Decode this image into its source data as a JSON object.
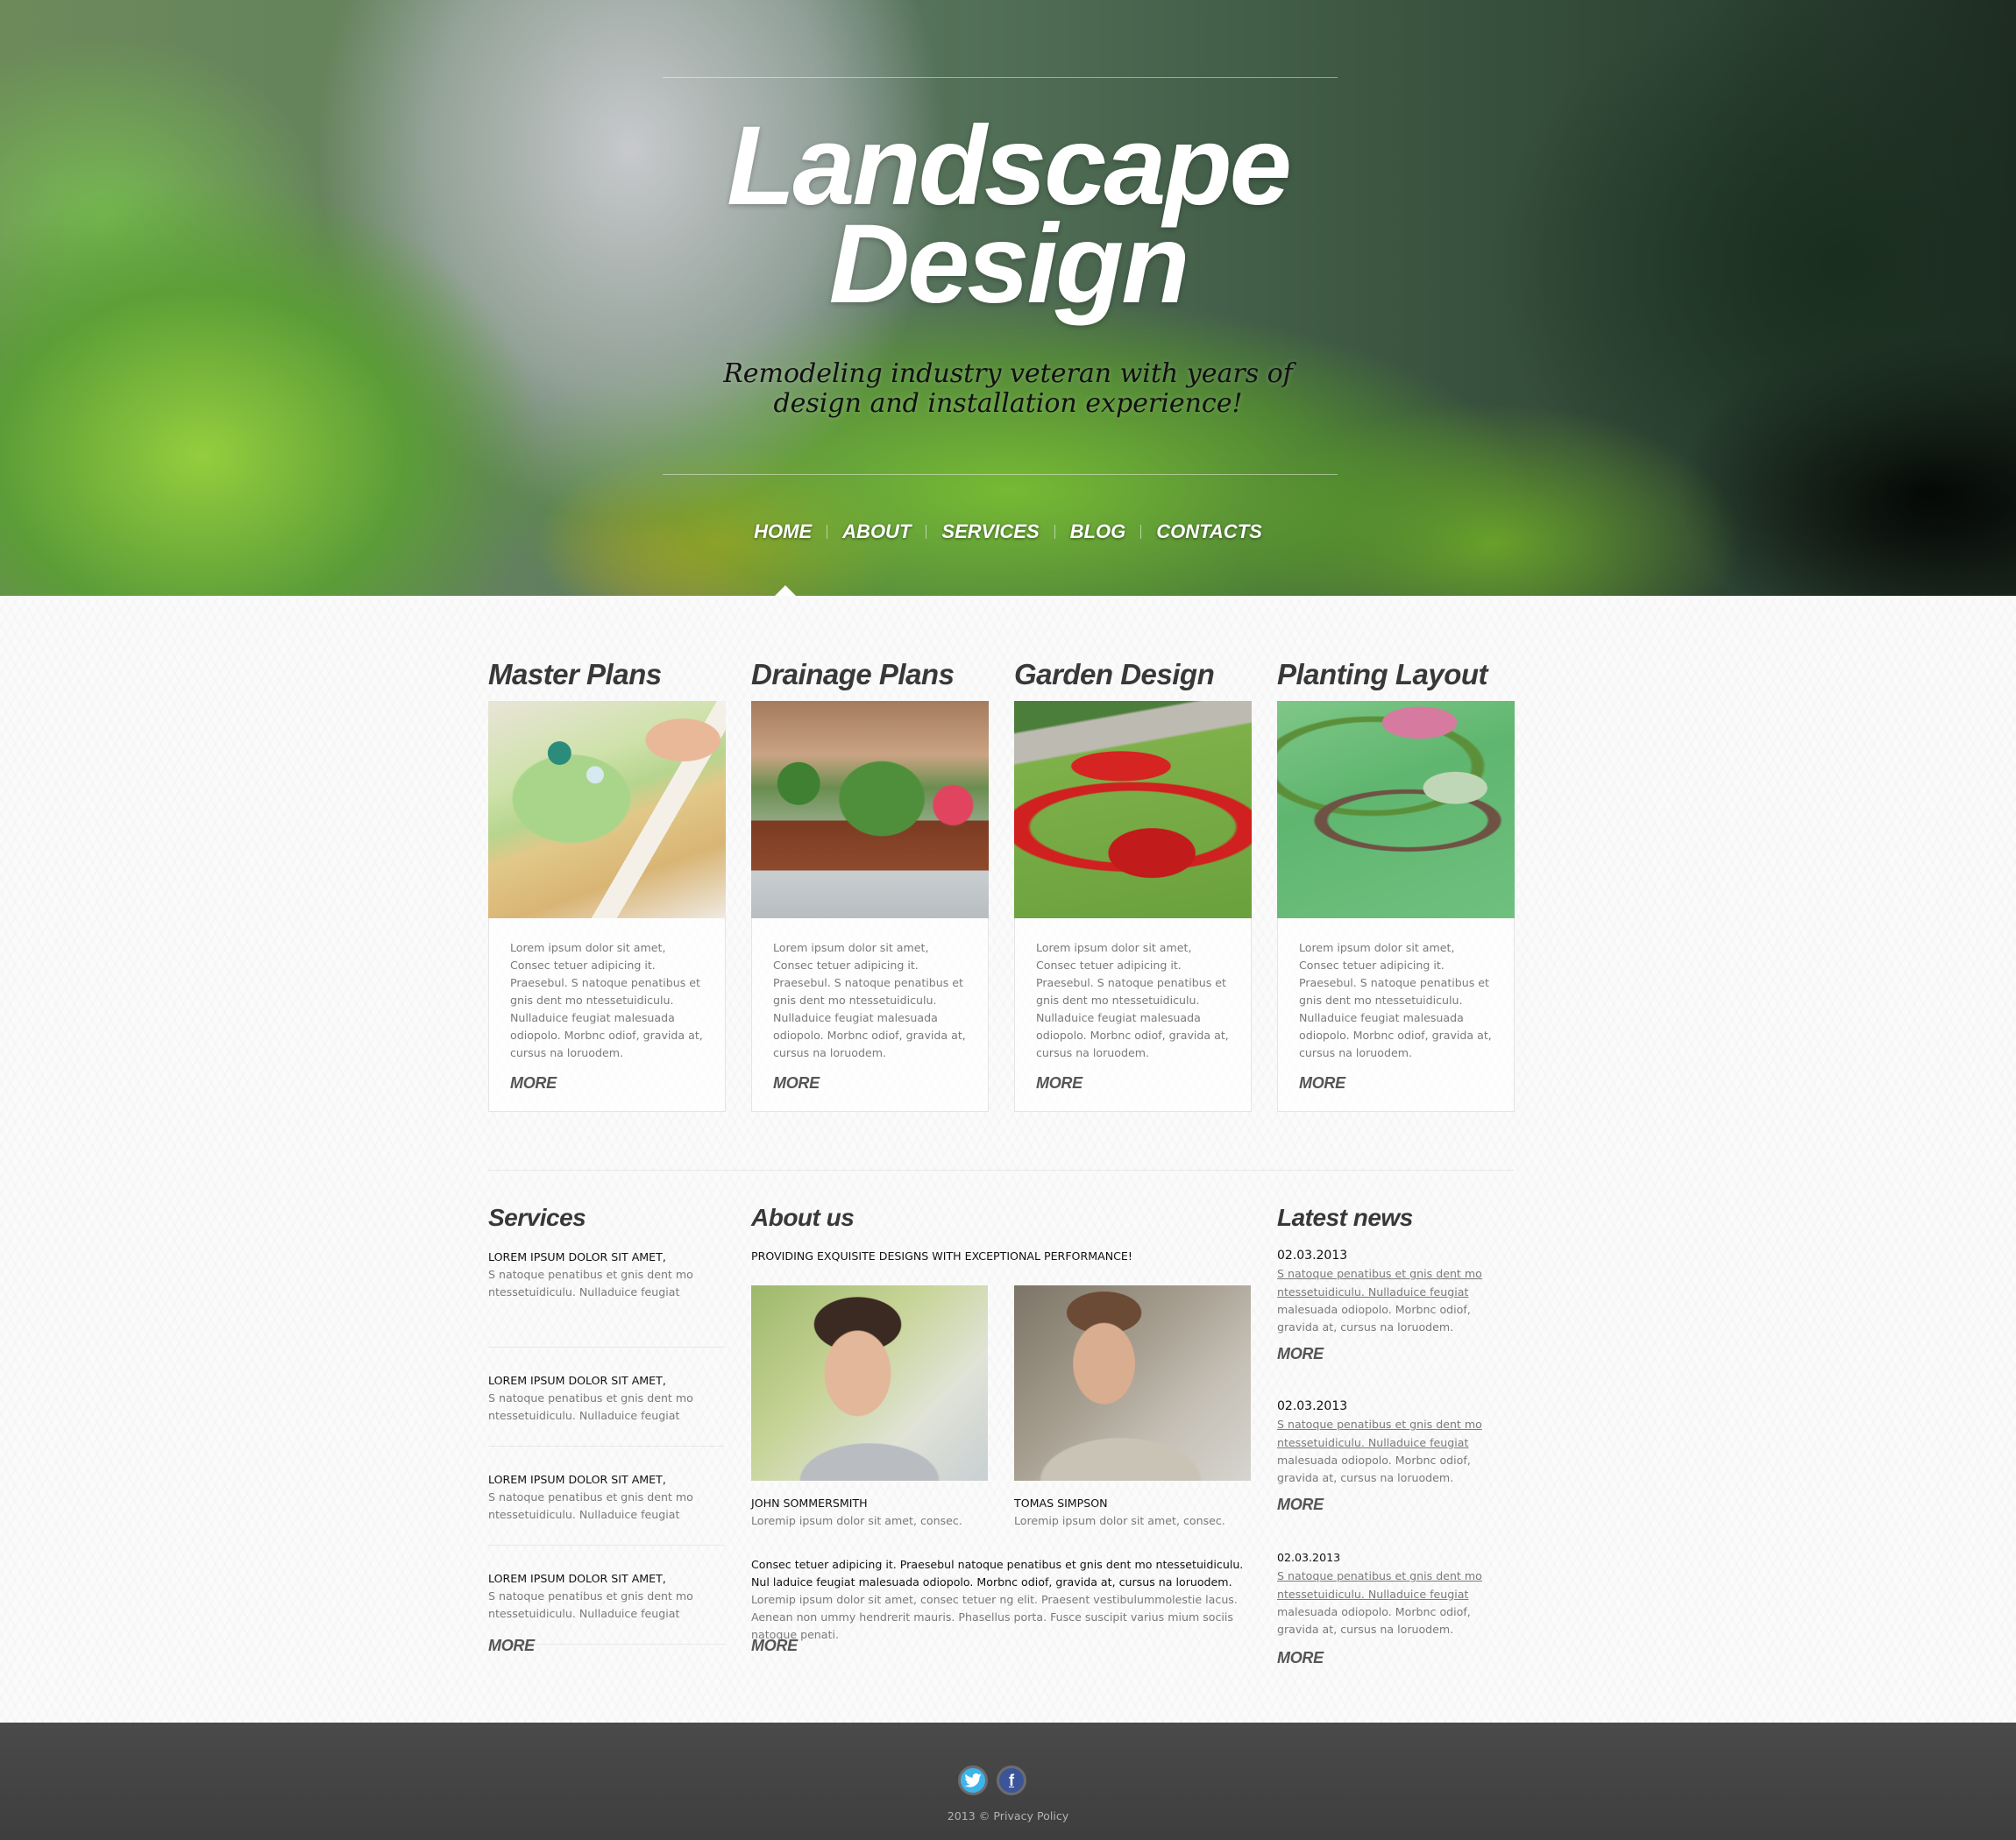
{
  "hero": {
    "title_line1": "Landscape",
    "title_line2": "Design",
    "subtitle_line1": "Remodeling industry veteran with years of",
    "subtitle_line2": "design and installation experience!"
  },
  "nav": {
    "items": [
      {
        "label": "HOME",
        "active": true
      },
      {
        "label": "ABOUT",
        "active": false
      },
      {
        "label": "SERVICES",
        "active": false
      },
      {
        "label": "BLOG",
        "active": false
      },
      {
        "label": "CONTACTS",
        "active": false
      }
    ]
  },
  "features": [
    {
      "title": "Master Plans",
      "image": "landscape-plan-drawing",
      "text": "Lorem ipsum dolor sit amet, Consec tetuer adipicing it. Praesebul. S natoque penatibus et gnis dent mo ntessetuidiculu. Nulladuice feugiat malesuada odiopolo. Morbnc odiof, gravida at, cursus na loruodem.",
      "more": "MORE"
    },
    {
      "title": "Drainage Plans",
      "image": "wooden-planters-with-shrubs",
      "text": "Lorem ipsum dolor sit amet, Consec tetuer adipicing it. Praesebul. S natoque penatibus et gnis dent mo ntessetuidiculu. Nulladuice feugiat malesuada odiopolo. Morbnc odiof, gravida at, cursus na loruodem.",
      "more": "MORE"
    },
    {
      "title": "Garden Design",
      "image": "red-flower-beds-on-lawn",
      "text": "Lorem ipsum dolor sit amet, Consec tetuer adipicing it. Praesebul. S natoque penatibus et gnis dent mo ntessetuidiculu. Nulladuice feugiat malesuada odiopolo. Morbnc odiof, gravida at, cursus na loruodem.",
      "more": "MORE"
    },
    {
      "title": "Planting Layout",
      "image": "hedge-maze-garden",
      "text": "Lorem ipsum dolor sit amet, Consec tetuer adipicing it. Praesebul. S natoque penatibus et gnis dent mo ntessetuidiculu. Nulladuice feugiat malesuada odiopolo. Morbnc odiof, gravida at, cursus na loruodem.",
      "more": "MORE"
    }
  ],
  "services": {
    "title": "Services",
    "items": [
      {
        "heading": "LOREM IPSUM DOLOR SIT AMET,",
        "text": "S natoque penatibus et gnis dent mo ntessetuidiculu. Nulladuice feugiat"
      },
      {
        "heading": "LOREM IPSUM DOLOR SIT AMET,",
        "text": "S natoque penatibus et gnis dent mo ntessetuidiculu. Nulladuice feugiat"
      },
      {
        "heading": "LOREM IPSUM DOLOR SIT AMET,",
        "text": "S natoque penatibus et gnis dent mo ntessetuidiculu. Nulladuice feugiat"
      },
      {
        "heading": "LOREM IPSUM DOLOR SIT AMET,",
        "text": "S natoque penatibus et gnis dent mo ntessetuidiculu. Nulladuice feugiat"
      }
    ],
    "more": "MORE"
  },
  "about": {
    "title": "About us",
    "tagline": "PROVIDING EXQUISITE DESIGNS WITH EXCEPTIONAL PERFORMANCE!",
    "people": [
      {
        "name": "JOHN SOMMERSMITH",
        "desc": "Loremip ipsum dolor sit amet, consec."
      },
      {
        "name": "TOMAS SIMPSON",
        "desc": "Loremip ipsum dolor sit amet, consec."
      }
    ],
    "text_dark": "Consec tetuer adipicing it. Praesebul natoque penatibus et gnis dent mo ntessetuidiculu. Nul laduice feugiat  malesuada odiopolo. Morbnc odiof,  gravida at, cursus na loruodem.",
    "text_light": "Loremip ipsum dolor sit amet, consec tetuer ng elit. Praesent vestibulummolestie lacus. Aenean non ummy hendrerit mauris. Phasellus porta. Fusce suscipit varius mium sociis natoque penati.",
    "more": "MORE"
  },
  "news": {
    "title": "Latest news",
    "items": [
      {
        "date": "02.03.2013",
        "link": "S natoque penatibus et gnis dent mo ntessetuidiculu. Nulladuice feugiat",
        "text": "malesuada odiopolo. Morbnc odiof, gravida at, cursus na loruodem.",
        "more": "MORE"
      },
      {
        "date": "02.03.2013",
        "link": "S natoque penatibus et gnis dent mo ntessetuidiculu. Nulladuice feugiat",
        "text": "malesuada odiopolo. Morbnc odiof, gravida at, cursus na loruodem.",
        "more": "MORE"
      },
      {
        "date": "02.03.2013",
        "link": "S natoque penatibus et gnis dent mo ntessetuidiculu. Nulladuice feugiat",
        "text": "malesuada odiopolo. Morbnc odiof, gravida at, cursus na loruodem.",
        "more": "MORE"
      }
    ]
  },
  "footer": {
    "social": [
      {
        "name": "twitter",
        "glyph": "🐦",
        "color": "#3db5ea"
      },
      {
        "name": "facebook",
        "glyph": "f",
        "color": "#3b5598"
      }
    ],
    "copyright": "2013 © Privacy Policy"
  }
}
